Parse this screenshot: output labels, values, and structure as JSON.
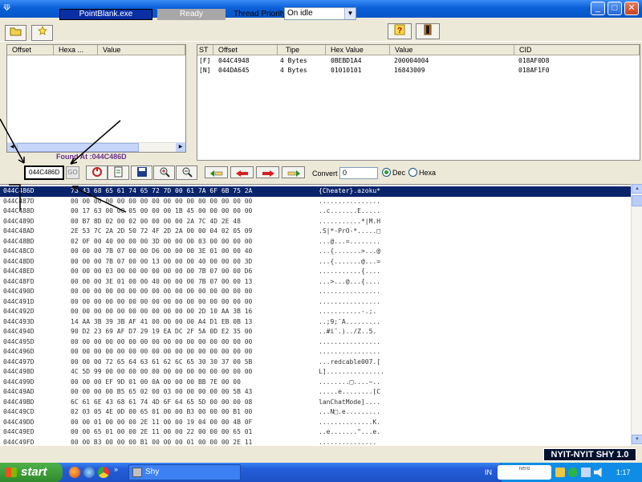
{
  "window": {
    "title_icon": "app-icon",
    "caption_buttons": [
      "minimize",
      "maximize",
      "close"
    ]
  },
  "toolbar": {
    "open_label": "",
    "process_name": "PointBlank.exe",
    "status": "Ready",
    "thread_priority_label": "Thread Priority :",
    "thread_priority_value": "On idle"
  },
  "left_results": {
    "columns": [
      "Offset",
      "Hexa ...",
      "Value"
    ]
  },
  "right_results": {
    "columns": [
      "ST",
      "Offset",
      "Tipe",
      "Hex Value",
      "Value",
      "CID"
    ],
    "rows": [
      [
        "[F]",
        "044C4948",
        "4 Bytes",
        "0BEBD1A4",
        "200004004",
        "018AF0D8"
      ],
      [
        "[N]",
        "044DA645",
        "4 Bytes",
        "01010101",
        "16843009",
        "018AF1F0"
      ]
    ]
  },
  "found_at": "Found At :044C486D",
  "address_bar": {
    "address": "044C486D",
    "go_label": "GO",
    "convert_label": "Convert :",
    "convert_value": "0",
    "dec_label": "Dec",
    "hexa_label": "Hexa",
    "dec_selected": true
  },
  "hex_dump": {
    "selected_index": 0,
    "rows": [
      {
        "addr": "044C486D",
        "bytes": "7B 43 68 65 61 74 65 72 7D 00 61 7A 6F 6B 75 2A",
        "ascii": "{Cheater}.azoku*"
      },
      {
        "addr": "044C487D",
        "bytes": "00 00 00 00 00 00 00 00 00 00 00 00 00 00 00 00",
        "ascii": "................"
      },
      {
        "addr": "044C488D",
        "bytes": "00 17 63 00 00 05 00 00 00 1B 45 00 00 00 00 00",
        "ascii": "..c.......E....."
      },
      {
        "addr": "044C489D",
        "bytes": "00 B7 8D 02 00 02 00 00 00 00 2A 7C 4D 2E 48",
        "ascii": "...........*|M.H"
      },
      {
        "addr": "044C48AD",
        "bytes": "2E 53 7C 2A 2D 50 72 4F 2D 2A 00 00 04 02 05 09",
        "ascii": ".S|*-PrO-*.....□"
      },
      {
        "addr": "044C48BD",
        "bytes": "02 0F 00 40 00 00 00 3D 00 00 00 03 00 00 00 00",
        "ascii": "...@...=........"
      },
      {
        "addr": "044C48CD",
        "bytes": "00 00 00 7B 07 00 00 D6 00 00 00 3E 01 00 00 40",
        "ascii": "...{.......>...@"
      },
      {
        "addr": "044C48DD",
        "bytes": "00 00 00 7B 07 00 00 13 00 00 00 40 00 00 00 3D",
        "ascii": "...{.......@...="
      },
      {
        "addr": "044C48ED",
        "bytes": "00 00 00 03 00 00 00 00 00 00 00 7B 07 00 00 D6",
        "ascii": "...........{...."
      },
      {
        "addr": "044C48FD",
        "bytes": "00 00 00 3E 01 00 00 40 00 00 00 7B 07 00 00 13",
        "ascii": "...>...@...{...."
      },
      {
        "addr": "044C490D",
        "bytes": "00 00 00 00 00 00 00 00 00 00 00 00 00 00 00 00",
        "ascii": "................"
      },
      {
        "addr": "044C491D",
        "bytes": "00 00 00 00 00 00 00 00 00 00 00 00 00 00 00 00",
        "ascii": "................"
      },
      {
        "addr": "044C492D",
        "bytes": "00 00 00 00 00 00 00 00 00 00 00 2D 10 AA 3B 16",
        "ascii": "...........-.;."
      },
      {
        "addr": "044C493D",
        "bytes": "14 AA 3B 39 3B AF 41 00 00 00 00 A4 D1 EB 0B 13",
        "ascii": "..;9;¯A........."
      },
      {
        "addr": "044C494D",
        "bytes": "90 D2 23 69 AF D7 29 19 EA DC 2F 5A 0D E2 35 00",
        "ascii": "..#i¯.)../Z..5."
      },
      {
        "addr": "044C495D",
        "bytes": "00 00 00 00 00 00 00 00 00 00 00 00 00 00 00 00",
        "ascii": "................"
      },
      {
        "addr": "044C496D",
        "bytes": "00 00 00 00 00 00 00 00 00 00 00 00 00 00 00 00",
        "ascii": "................"
      },
      {
        "addr": "044C497D",
        "bytes": "00 00 00 72 65 64 63 61 62 6C 65 30 30 37 00 5B",
        "ascii": "...redcable007.["
      },
      {
        "addr": "044C498D",
        "bytes": "4C 5D 99 00 00 00 00 00 00 00 00 00 00 00 00 00",
        "ascii": "L]..............."
      },
      {
        "addr": "044C499D",
        "bytes": "00 00 00 EF 9D 01 00 0A 00 00 00 BB 7E 00 00",
        "ascii": "........□....~.."
      },
      {
        "addr": "044C49AD",
        "bytes": "00 00 00 00 B5 65 02 00 03 00 00 00 00 00 5B 43",
        "ascii": ".....e........[C"
      },
      {
        "addr": "044C49BD",
        "bytes": "6C 61 6E 43 68 61 74 4D 6F 64 65 5D 00 00 00 08",
        "ascii": "lanChatMode]...."
      },
      {
        "addr": "044C49CD",
        "bytes": "02 03 05 4E 0D 00 65 01 00 00 B3 00 00 00 B1 00",
        "ascii": "...N□.e........."
      },
      {
        "addr": "044C49DD",
        "bytes": "00 00 01 00 00 00 2E 11 00 00 19 04 00 00 4B 0F",
        "ascii": "..............K."
      },
      {
        "addr": "044C49ED",
        "bytes": "00 00 65 01 00 00 2E 11 00 00 22 00 00 00 65 01",
        "ascii": "..e.......\"...e."
      },
      {
        "addr": "044C49FD",
        "bytes": "00 00 B3 00 00 00 B1 00 00 00 01 00 00 00 2E 11",
        "ascii": "..............."
      }
    ]
  },
  "brand": "NYIT-NYIT SHY 1.0",
  "taskbar": {
    "start_label": "start",
    "task_label": "Shy",
    "language": "IN",
    "tray_badge": "nero",
    "clock": "1:17"
  },
  "colors": {
    "selection": "#0a246a",
    "process_bg": "#0a2fa3",
    "found_at": "#6a2f8c",
    "brand_bg": "#00112e"
  }
}
